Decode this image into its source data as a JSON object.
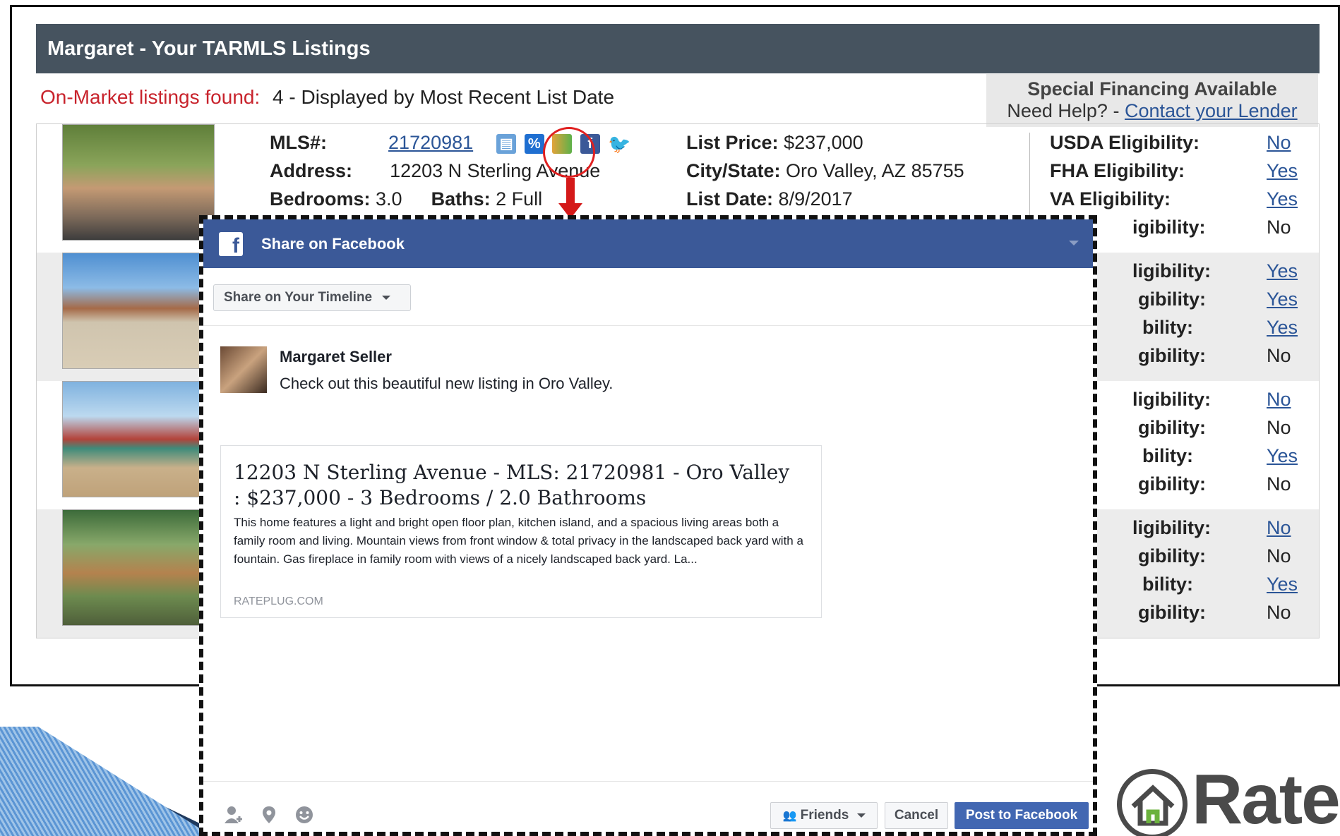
{
  "header": {
    "title": "Margaret - Your TARMLS Listings"
  },
  "summary": {
    "found_label": "On-Market listings found:",
    "found_value": "4 - Displayed by Most Recent List Date"
  },
  "financing": {
    "title": "Special Financing Available",
    "help_prefix": "Need Help? -",
    "lender_link": "Contact your Lender"
  },
  "listing": {
    "mls_label": "MLS#:",
    "mls": "21720981",
    "address_label": "Address:",
    "address": "12203 N Sterling Avenue",
    "bedrooms_label": "Bedrooms:",
    "bedrooms": "3.0",
    "baths_label": "Baths:",
    "baths": "2 Full",
    "price_label": "List Price:",
    "price": "$237,000",
    "city_label": "City/State:",
    "city": "Oro Valley, AZ 85755",
    "date_label": "List Date:",
    "date": "8/9/2017"
  },
  "eligibility_labels": [
    "USDA Eligibility:",
    "FHA Eligibility:",
    "VA Eligibility:",
    "igibility:",
    "ligibility:",
    "gibility:",
    "bility:",
    "ibility:"
  ],
  "eligibility": [
    {
      "labels": [
        "USDA Eligibility:",
        "FHA Eligibility:",
        "VA Eligibility:",
        "igibility:"
      ],
      "values": [
        "No",
        "Yes",
        "Yes",
        "No"
      ],
      "links": [
        true,
        true,
        true,
        false
      ]
    },
    {
      "labels": [
        "ligibility:",
        "gibility:",
        "bility:",
        "gibility:"
      ],
      "values": [
        "Yes",
        "Yes",
        "Yes",
        "No"
      ],
      "links": [
        true,
        true,
        true,
        false
      ]
    },
    {
      "labels": [
        "ligibility:",
        "gibility:",
        "bility:",
        "gibility:"
      ],
      "values": [
        "No",
        "No",
        "Yes",
        "No"
      ],
      "links": [
        true,
        false,
        true,
        false
      ]
    },
    {
      "labels": [
        "ligibility:",
        "gibility:",
        "bility:",
        "gibility:"
      ],
      "values": [
        "No",
        "No",
        "Yes",
        "No"
      ],
      "links": [
        true,
        false,
        true,
        false
      ]
    }
  ],
  "facebook": {
    "dialog_title": "Share on Facebook",
    "share_target": "Share on Your Timeline",
    "poster_name": "Margaret Seller",
    "post_text": "Check out this beautiful new listing in Oro Valley.",
    "card_title": "12203 N Sterling Avenue - MLS: 21720981 - Oro Valley : $237,000 - 3 Bedrooms / 2.0 Bathrooms",
    "card_description": "This home features a light and bright open floor plan, kitchen island, and a spacious living areas both a family room and living. Mountain views from front window & total privacy in the landscaped back yard with a fountain. Gas fireplace in family room with views of a nicely landscaped back yard. La...",
    "card_domain": "RATEPLUG.COM",
    "friends_label": "Friends",
    "cancel_label": "Cancel",
    "post_label": "Post to Facebook"
  },
  "logo_text": "Rate",
  "colors": {
    "header_bg": "#46535f",
    "facebook_blue": "#3b5998",
    "post_button": "#4267b2",
    "highlight_red": "#e02020",
    "link_blue": "#2b5597"
  }
}
